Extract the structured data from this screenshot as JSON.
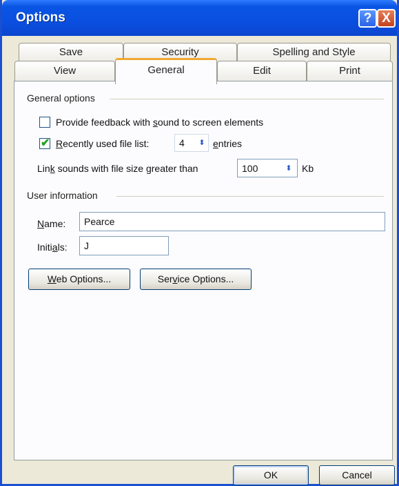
{
  "window": {
    "title": "Options",
    "help_glyph": "?",
    "close_glyph": "X"
  },
  "tabs": {
    "row1": [
      {
        "label": "Save"
      },
      {
        "label": "Security"
      },
      {
        "label": "Spelling and Style"
      }
    ],
    "row2": [
      {
        "label": "View"
      },
      {
        "label": "General",
        "active": true
      },
      {
        "label": "Edit"
      },
      {
        "label": "Print"
      }
    ]
  },
  "general_options": {
    "heading": "General options",
    "feedback_pre": "Provide feedback with ",
    "feedback_mn": "s",
    "feedback_post": "ound to screen elements",
    "feedback_checked": false,
    "recent_mn": "R",
    "recent_post": "ecently used file list:",
    "recent_checked": true,
    "recent_count": "4",
    "entries_mn": "e",
    "entries_post": "ntries",
    "link_pre": "Lin",
    "link_mn": "k",
    "link_post": " sounds with file size greater than",
    "link_size": "100",
    "link_unit": "Kb"
  },
  "user_information": {
    "heading": "User information",
    "name_mn": "N",
    "name_post": "ame:",
    "name_value": "Pearce",
    "initials_pre": "Initi",
    "initials_mn": "a",
    "initials_post": "ls:",
    "initials_value": "J"
  },
  "buttons": {
    "web_mn": "W",
    "web_post": "eb Options...",
    "service_pre": "Ser",
    "service_mn": "v",
    "service_post": "ice Options...",
    "ok": "OK",
    "cancel": "Cancel"
  },
  "colors": {
    "titlebar": "#0a4fe0",
    "active_tab_accent": "#f0a830",
    "dialog_face": "#ece9d8"
  },
  "icons": {
    "help": "help-icon",
    "close": "close-icon",
    "checkmark": "checkmark-icon",
    "spinner": "spinner-arrows-icon"
  }
}
